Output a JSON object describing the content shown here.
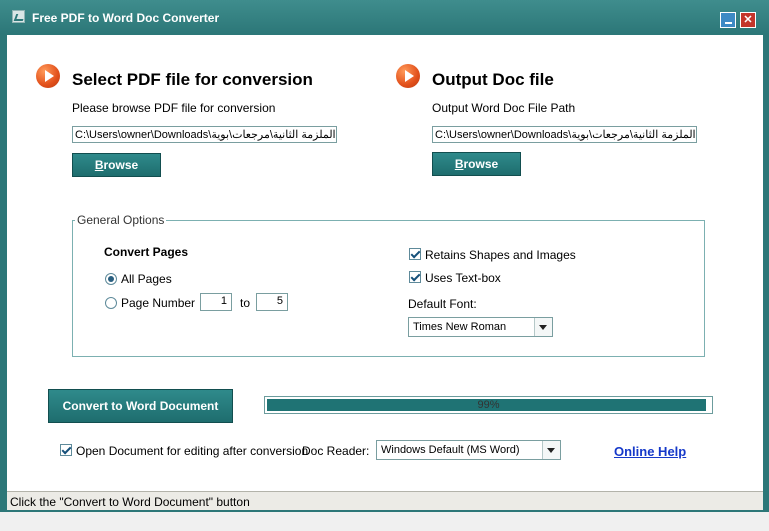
{
  "window": {
    "title": "Free PDF to Word Doc Converter"
  },
  "input_section": {
    "heading": "Select PDF file for conversion",
    "label": "Please browse PDF file for conversion",
    "path": "C:\\Users\\owner\\Downloads\\الملزمة الثانية\\مرجعات\\بوية",
    "browse_label_prefix": "B",
    "browse_label_rest": "rowse"
  },
  "output_section": {
    "heading": "Output Doc file",
    "label": "Output Word Doc File Path",
    "path": "C:\\Users\\owner\\Downloads\\الملزمة الثانية\\مرجعات\\بوية",
    "browse_label_prefix": "B",
    "browse_label_rest": "rowse"
  },
  "general_options": {
    "legend": "General Options",
    "convert_pages_heading": "Convert Pages",
    "all_pages_label": "All Pages",
    "all_pages_selected": true,
    "page_number_label": "Page Number",
    "page_number_selected": false,
    "page_from": "1",
    "to_label": "to",
    "page_to": "5",
    "retains_shapes_label": "Retains Shapes and Images",
    "retains_shapes_checked": true,
    "uses_textbox_label": "Uses Text-box",
    "uses_textbox_checked": true,
    "default_font_label": "Default Font:",
    "default_font_value": "Times New Roman"
  },
  "conversion": {
    "convert_button_label": "Convert to Word Document",
    "progress_text": "99%",
    "progress_value": 0.99
  },
  "footer_options": {
    "open_document_label": "Open Document for editing after conversion",
    "open_document_checked": true,
    "doc_reader_label": "Doc Reader:",
    "doc_reader_value": "Windows Default (MS Word)",
    "online_help_label": "Online Help"
  },
  "status_bar": {
    "text": "Click the \"Convert to Word Document\" button"
  },
  "colors": {
    "frame": "#2c7778",
    "button": "#1e6d6e",
    "progress": "#1f7374",
    "link": "#1538c9",
    "play_icon": "#e2501b"
  }
}
